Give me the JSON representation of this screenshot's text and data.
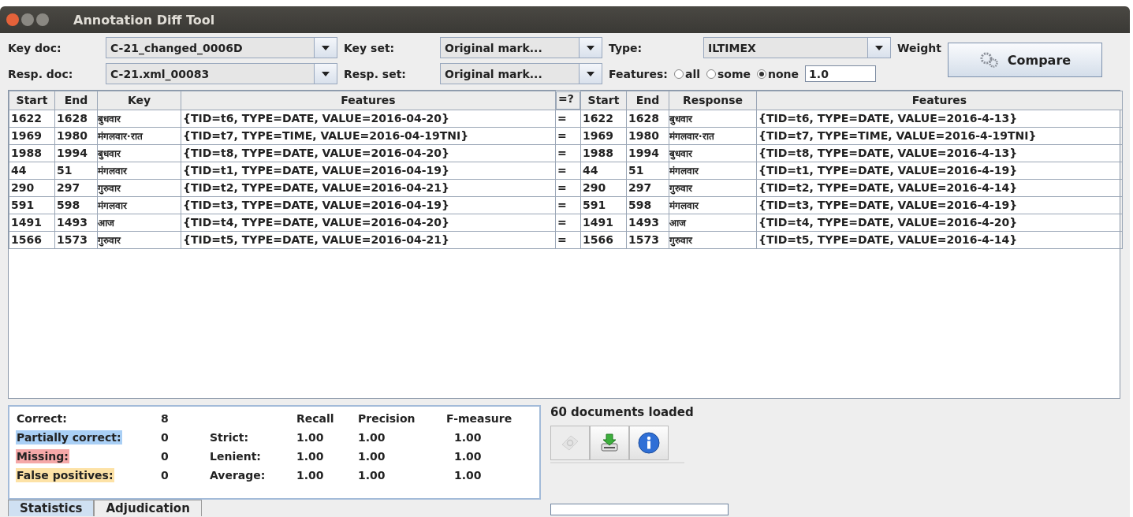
{
  "window": {
    "title": "Annotation Diff Tool"
  },
  "form": {
    "key_doc_label": "Key doc:",
    "key_doc": "C-21_changed_0006D",
    "key_set_label": "Key set:",
    "key_set": "Original mark...",
    "type_label": "Type:",
    "type": "ILTIMEX",
    "weight_label": "Weight",
    "resp_doc_label": "Resp. doc:",
    "resp_doc": "C-21.xml_00083",
    "resp_set_label": "Resp. set:",
    "resp_set": "Original mark...",
    "features_label": "Features:",
    "features_options": [
      {
        "label": "all",
        "selected": false
      },
      {
        "label": "some",
        "selected": false
      },
      {
        "label": "none",
        "selected": true
      }
    ],
    "weight": "1.0",
    "compare_button": "Compare"
  },
  "table": {
    "columns": [
      "Start",
      "End",
      "Key",
      "Features",
      "=?",
      "Start",
      "End",
      "Response",
      "Features"
    ],
    "rows": [
      [
        "1622",
        "1628",
        "बुधवार",
        "{TID=t6, TYPE=DATE, VALUE=2016-04-20}",
        "=",
        "1622",
        "1628",
        "बुधवार",
        "{TID=t6, TYPE=DATE, VALUE=2016-4-13}"
      ],
      [
        "1969",
        "1980",
        "मंगलवार·रात",
        "{TID=t7, TYPE=TIME, VALUE=2016-04-19TNI}",
        "=",
        "1969",
        "1980",
        "मंगलवार·रात",
        "{TID=t7, TYPE=TIME, VALUE=2016-4-19TNI}"
      ],
      [
        "1988",
        "1994",
        "बुधवार",
        "{TID=t8, TYPE=DATE, VALUE=2016-04-20}",
        "=",
        "1988",
        "1994",
        "बुधवार",
        "{TID=t8, TYPE=DATE, VALUE=2016-4-13}"
      ],
      [
        "44",
        "51",
        "मंगलवार",
        "{TID=t1, TYPE=DATE, VALUE=2016-04-19}",
        "=",
        "44",
        "51",
        "मंगलवार",
        "{TID=t1, TYPE=DATE, VALUE=2016-4-19}"
      ],
      [
        "290",
        "297",
        "गुरुवार",
        "{TID=t2, TYPE=DATE, VALUE=2016-04-21}",
        "=",
        "290",
        "297",
        "गुरुवार",
        "{TID=t2, TYPE=DATE, VALUE=2016-4-14}"
      ],
      [
        "591",
        "598",
        "मंगलवार",
        "{TID=t3, TYPE=DATE, VALUE=2016-04-19}",
        "=",
        "591",
        "598",
        "मंगलवार",
        "{TID=t3, TYPE=DATE, VALUE=2016-4-19}"
      ],
      [
        "1491",
        "1493",
        "आज",
        "{TID=t4, TYPE=DATE, VALUE=2016-04-20}",
        "=",
        "1491",
        "1493",
        "आज",
        "{TID=t4, TYPE=DATE, VALUE=2016-4-20}"
      ],
      [
        "1566",
        "1573",
        "गुरुवार",
        "{TID=t5, TYPE=DATE, VALUE=2016-04-21}",
        "=",
        "1566",
        "1573",
        "गुरुवार",
        "{TID=t5, TYPE=DATE, VALUE=2016-4-14}"
      ]
    ]
  },
  "statistics": {
    "counts": [
      {
        "label": "Correct:",
        "value": "8",
        "color": "#ffffff"
      },
      {
        "label": "Partially correct:",
        "value": "0",
        "color": "#a9cff5"
      },
      {
        "label": "Missing:",
        "value": "0",
        "color": "#f5a8a8"
      },
      {
        "label": "False positives:",
        "value": "0",
        "color": "#fde2a6"
      }
    ],
    "measure_headers": [
      "Recall",
      "Precision",
      "F-measure"
    ],
    "measures": [
      {
        "label": "Strict:",
        "values": [
          "1.00",
          "1.00",
          "1.00"
        ]
      },
      {
        "label": "Lenient:",
        "values": [
          "1.00",
          "1.00",
          "1.00"
        ]
      },
      {
        "label": "Average:",
        "values": [
          "1.00",
          "1.00",
          "1.00"
        ]
      }
    ]
  },
  "tabs": [
    {
      "label": "Statistics",
      "selected": true
    },
    {
      "label": "Adjudication",
      "selected": false
    }
  ],
  "status": "60 documents loaded",
  "toolbar": [
    {
      "kind": "gate",
      "disabled": true
    },
    {
      "kind": "export",
      "disabled": false
    },
    {
      "kind": "info",
      "disabled": false
    }
  ]
}
